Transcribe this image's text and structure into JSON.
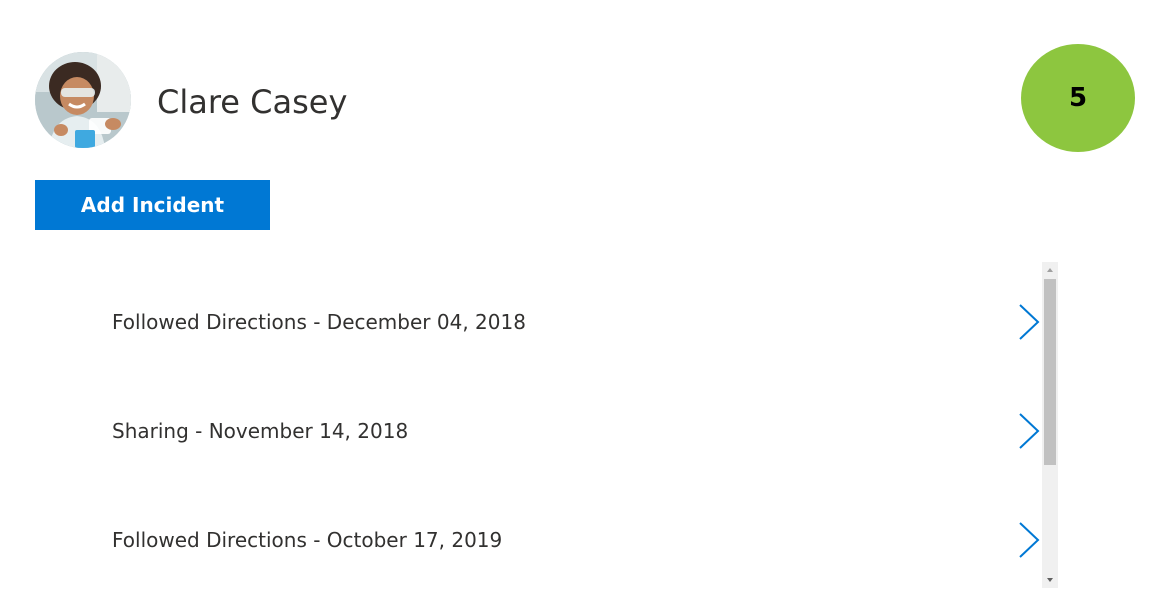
{
  "student": {
    "name": "Clare Casey",
    "avatar_icon": "student-photo",
    "score": "5",
    "score_color": "#8dc63f"
  },
  "actions": {
    "add_incident_label": "Add Incident",
    "accent_color": "#0078d4"
  },
  "incidents": [
    {
      "label": "Followed Directions - December 04, 2018",
      "icon": "chevron-right-icon"
    },
    {
      "label": "Sharing - November 14, 2018",
      "icon": "chevron-right-icon"
    },
    {
      "label": "Followed Directions - October 17, 2019",
      "icon": "chevron-right-icon"
    }
  ]
}
